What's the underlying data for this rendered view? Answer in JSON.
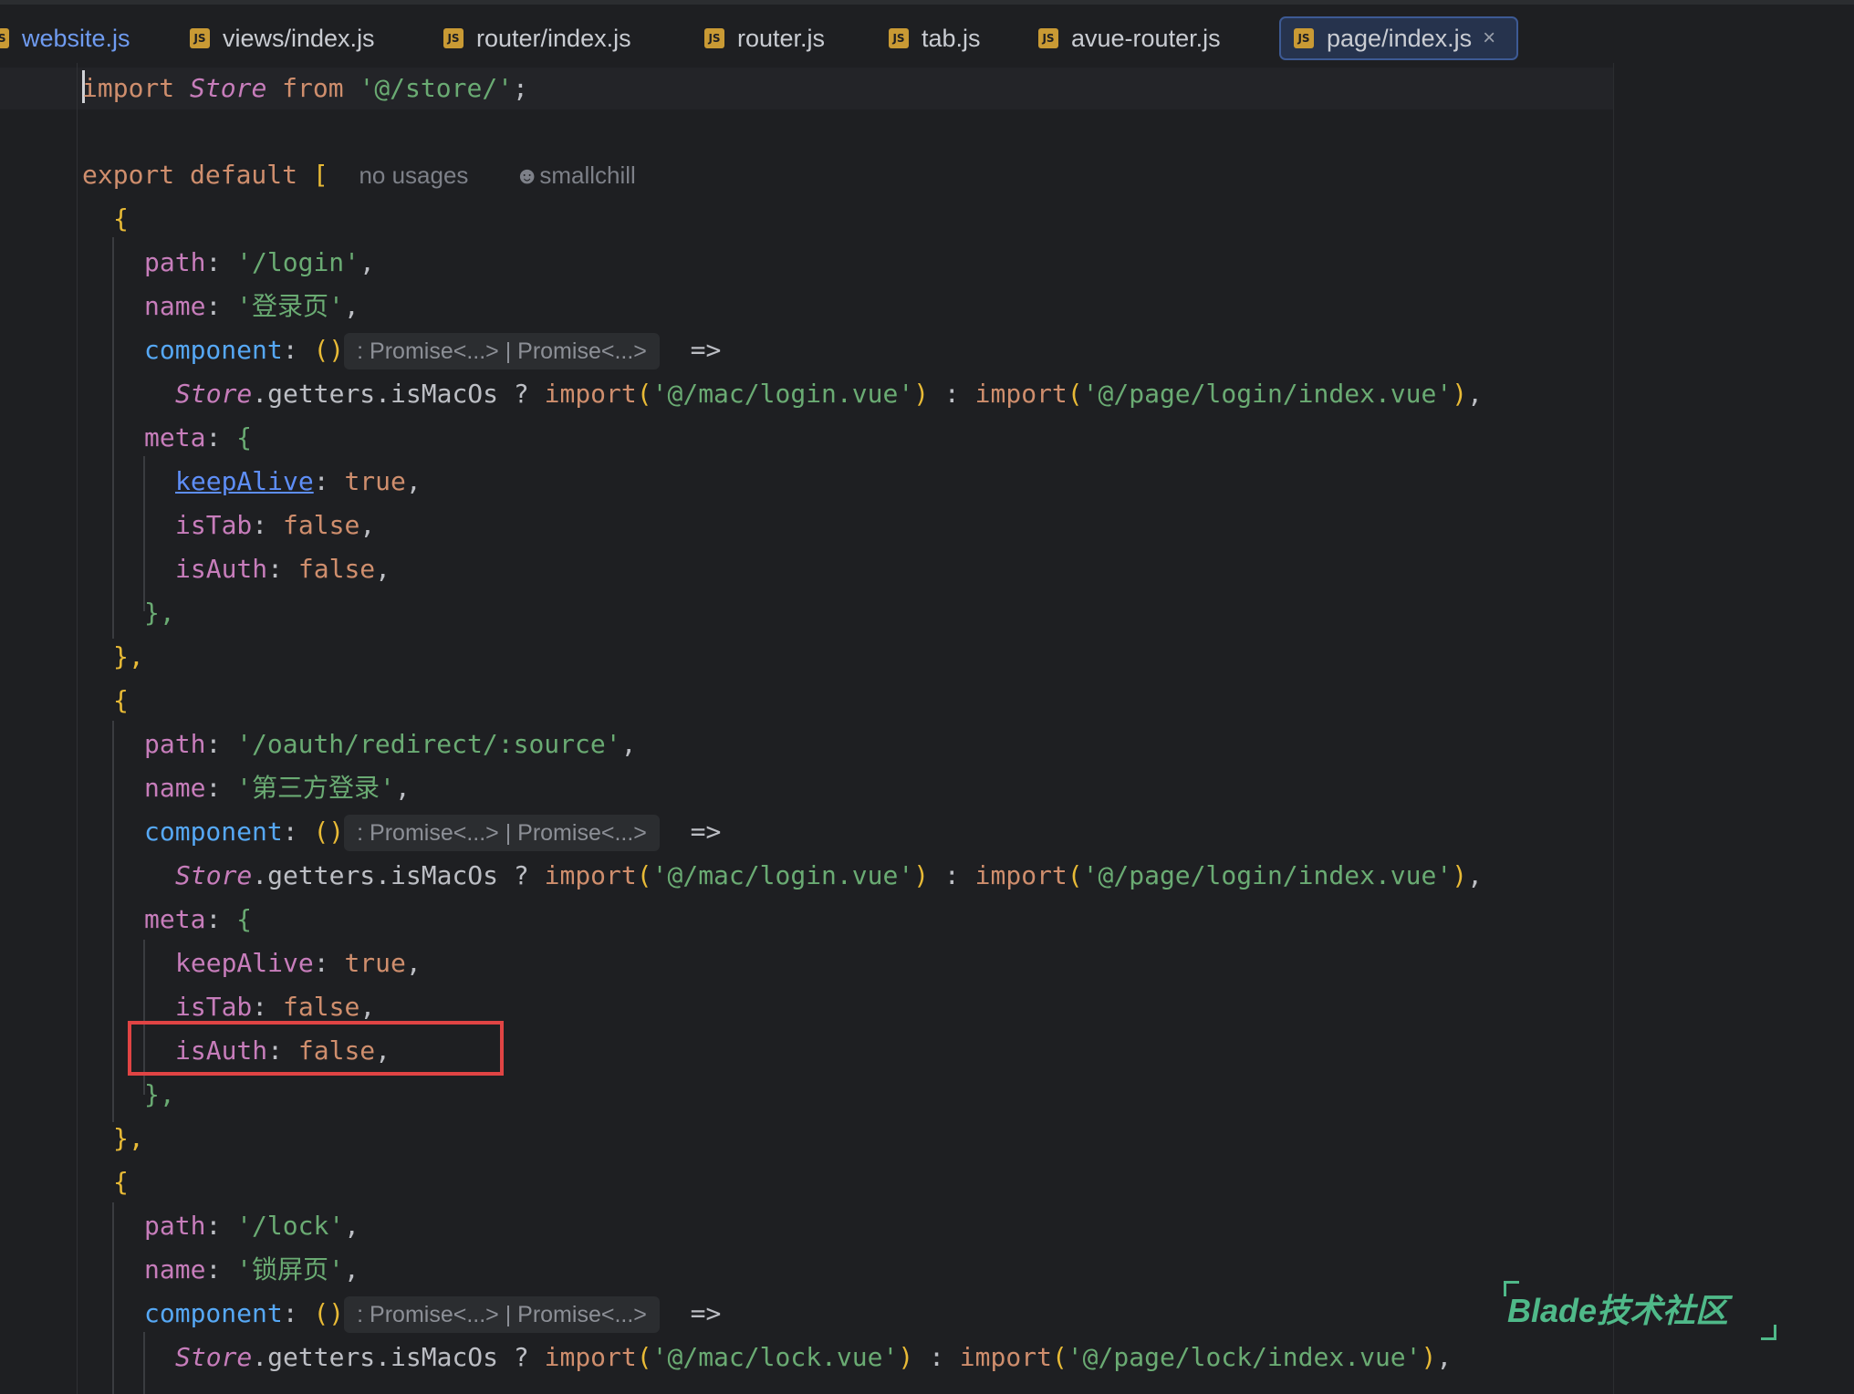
{
  "tabs": [
    {
      "label": "website.js",
      "icon": "js-file-icon"
    },
    {
      "label": "views/index.js",
      "icon": "js-file-icon"
    },
    {
      "label": "router/index.js",
      "icon": "js-file-icon"
    },
    {
      "label": "router.js",
      "icon": "js-file-icon"
    },
    {
      "label": "tab.js",
      "icon": "js-file-icon"
    },
    {
      "label": "avue-router.js",
      "icon": "js-file-icon"
    },
    {
      "label": "page/index.js",
      "icon": "js-file-icon",
      "active": true
    }
  ],
  "icon_text": "JS",
  "close_glyph": "×",
  "code": {
    "l1_kw": "import",
    "l1_store": "Store",
    "l1_from": "from",
    "l1_str": "'@/store/'",
    "l1_semi": ";",
    "l3_export": "export default",
    "l3_bracket": "[",
    "l3_usages": "no usages",
    "l3_author": "smallchill",
    "open_brace": "{",
    "close_brace_comma": "},",
    "path_key": "path",
    "name_key": "name",
    "component_key": "component",
    "meta_key": "meta",
    "colon": ":",
    "comma": ",",
    "arrow": "=>",
    "parens": "()",
    "type_hint": ": Promise<...> | Promise<...>",
    "getters": ".getters.",
    "ismacos": "isMacOs",
    "q": "?",
    "c": ":",
    "import_fn": "import",
    "keepalive_key": "keepAlive",
    "istab_key": "isTab",
    "isauth_key": "isAuth",
    "true": "true",
    "false": "false",
    "route1": {
      "path": "'/login'",
      "name": "'登录页'",
      "mac": "'@/mac/login.vue'",
      "page": "'@/page/login/index.vue'"
    },
    "route2": {
      "path": "'/oauth/redirect/:source'",
      "name": "'第三方登录'",
      "mac": "'@/mac/login.vue'",
      "page": "'@/page/login/index.vue'"
    },
    "route3": {
      "path": "'/lock'",
      "name": "'锁屏页'",
      "mac": "'@/mac/lock.vue'",
      "page": "'@/page/lock/index.vue'"
    }
  },
  "watermark": "Blade技术社区",
  "colors": {
    "keyword": "#cf8e6d",
    "string": "#6aab73",
    "property": "#c77dbb",
    "function": "#56a8f5",
    "highlight": "#e04444"
  }
}
